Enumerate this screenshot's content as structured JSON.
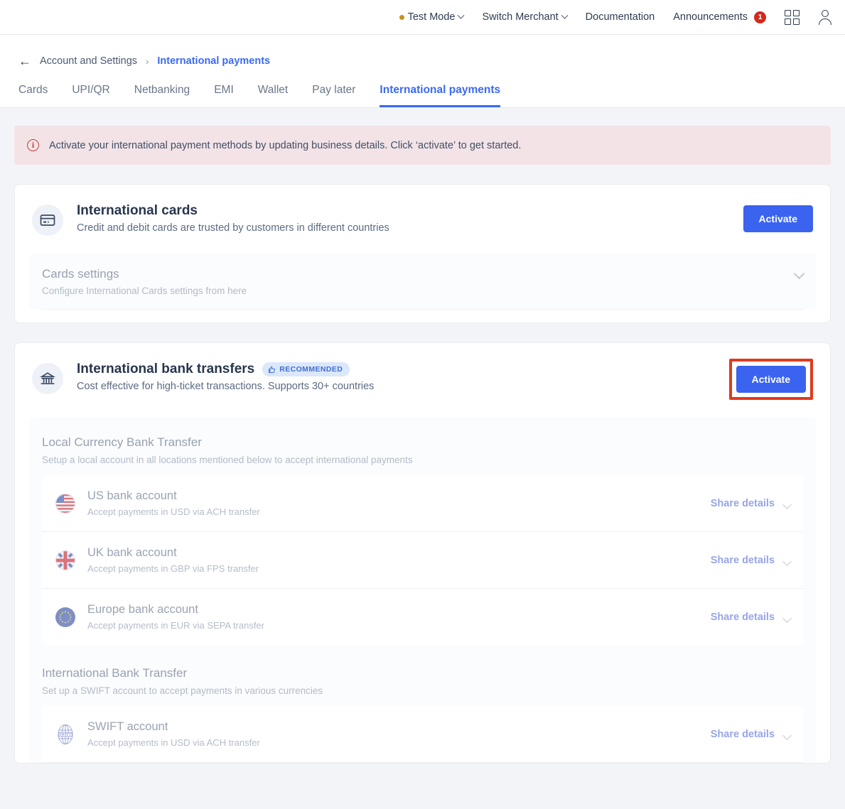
{
  "topbar": {
    "test_mode": "Test Mode",
    "switch_merchant": "Switch Merchant",
    "documentation": "Documentation",
    "announcements": "Announcements",
    "announcements_count": "1",
    "apps_icon": "grid-apps-icon",
    "account_icon": "person-icon",
    "test_dot_color": "#c7911f",
    "badge_color": "#d12a1e"
  },
  "breadcrumb": {
    "back": "←",
    "parent": "Account and Settings",
    "separator": "›",
    "current": "International payments"
  },
  "tabs": [
    {
      "label": "Cards",
      "active": false
    },
    {
      "label": "UPI/QR",
      "active": false
    },
    {
      "label": "Netbanking",
      "active": false
    },
    {
      "label": "EMI",
      "active": false
    },
    {
      "label": "Wallet",
      "active": false
    },
    {
      "label": "Pay later",
      "active": false
    },
    {
      "label": "International payments",
      "active": true
    }
  ],
  "alert": {
    "icon": "info-circle-icon",
    "text": "Activate your international payment methods by updating business details. Click ‘activate’ to get started.",
    "background": "#f3e3e6",
    "icon_color": "#c2413a"
  },
  "cards_section": {
    "icon": "credit-card-icon",
    "title": "International cards",
    "subtitle": "Credit and debit cards are trusted by customers in different countries",
    "activate_label": "Activate",
    "settings": {
      "title": "Cards settings",
      "description": "Configure International Cards settings from here",
      "chevron": "chevron-down-icon"
    }
  },
  "bank_section": {
    "icon": "bank-icon",
    "title": "International bank transfers",
    "badge": "RECOMMENDED",
    "badge_icon": "thumbs-up-icon",
    "subtitle": "Cost effective for high-ticket transactions. Supports 30+ countries",
    "activate_label": "Activate",
    "highlight_color": "#e03a1e",
    "local": {
      "title": "Local Currency Bank Transfer",
      "description": "Setup a local account in all locations mentioned below to accept international payments",
      "accounts": [
        {
          "flag": "us-flag-icon",
          "name": "US bank account",
          "description": "Accept payments in USD via ACH transfer",
          "action": "Share details"
        },
        {
          "flag": "uk-flag-icon",
          "name": "UK bank account",
          "description": "Accept payments in GBP via FPS transfer",
          "action": "Share details"
        },
        {
          "flag": "eu-flag-icon",
          "name": "Europe bank account",
          "description": "Accept payments in EUR via SEPA transfer",
          "action": "Share details"
        }
      ]
    },
    "international": {
      "title": "International Bank Transfer",
      "description": "Set up a SWIFT account to accept payments in various currencies",
      "accounts": [
        {
          "flag": "swift-globe-icon",
          "name": "SWIFT account",
          "description": "Accept payments in USD via ACH transfer",
          "action": "Share details"
        }
      ]
    }
  },
  "colors": {
    "accent_blue": "#3a63f0",
    "page_bg": "#f2f4f8",
    "card_bg": "#ffffff"
  }
}
